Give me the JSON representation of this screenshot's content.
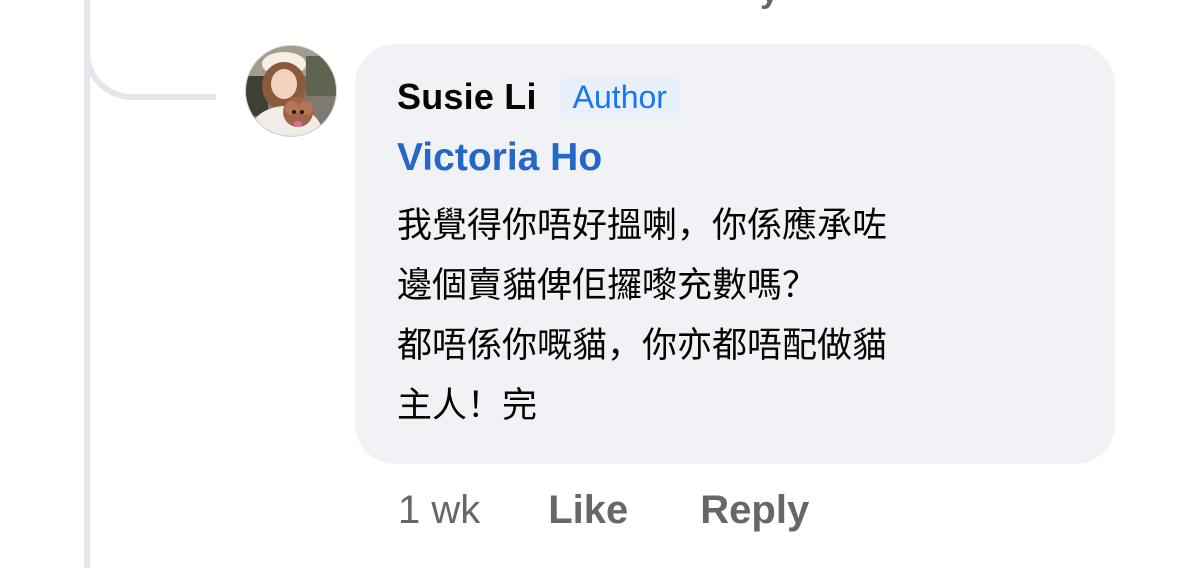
{
  "previous_comment": {
    "clipped_action_label": "y"
  },
  "comment": {
    "author": {
      "name": "Susie Li",
      "badge": "Author",
      "avatar_icon": "profile-photo-icon"
    },
    "mention": "Victoria Ho",
    "body_lines": [
      "我覺得你唔好搵喇，你係應承咗",
      "邊個賣貓俾佢攞嚟充數嗎？",
      "都唔係你嘅貓，你亦都唔配做貓",
      "主人！完"
    ],
    "timestamp": "1 wk",
    "actions": {
      "like_label": "Like",
      "reply_label": "Reply"
    }
  },
  "colors": {
    "bubble_background": "#f0f2f5",
    "badge_text": "#1877f2",
    "mention_text": "#2467c6",
    "secondary_text": "#65676b",
    "thread_line": "#e4e6eb"
  }
}
